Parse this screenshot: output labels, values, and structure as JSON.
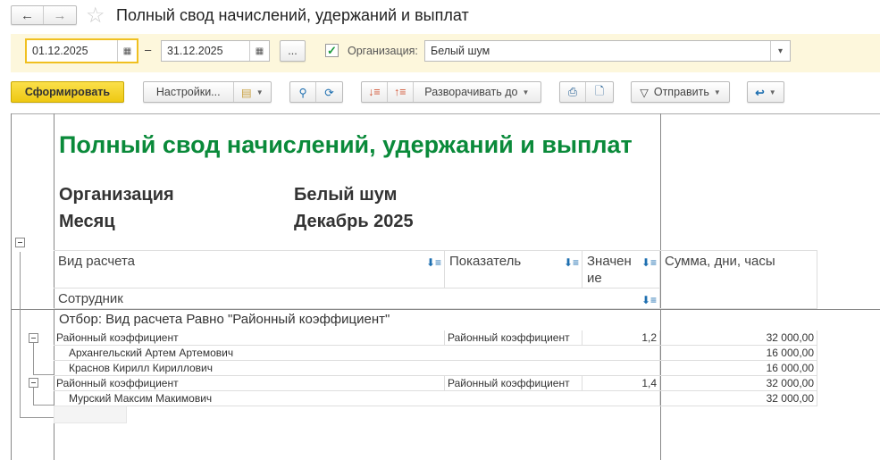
{
  "header": {
    "title": "Полный свод начислений, удержаний и выплат",
    "back": "←",
    "forward": "→",
    "star": "☆"
  },
  "filters": {
    "date_from": "01.12.2025",
    "date_to": "31.12.2025",
    "dash": "–",
    "more": "...",
    "org_label": "Организация:",
    "org_value": "Белый шум",
    "org_checked": true
  },
  "toolbar": {
    "generate": "Сформировать",
    "settings": "Настройки...",
    "expand_to": "Разворачивать до",
    "send": "Отправить"
  },
  "report": {
    "title": "Полный свод начислений, удержаний и выплат",
    "params": [
      {
        "label": "Организация",
        "value": "Белый шум"
      },
      {
        "label": "Месяц",
        "value": "Декабрь 2025"
      }
    ],
    "columns": {
      "calc_type": "Вид расчета",
      "indicator": "Показатель",
      "value": "Значен ие",
      "amount": "Сумма, дни, часы",
      "employee": "Сотрудник"
    },
    "filter_text": "Отбор: Вид расчета Равно \"Районный коэффициент\"",
    "rows": [
      {
        "name": "Районный коэффициент",
        "indicator": "Районный коэффициент",
        "value": "1,2",
        "amount": "32 000,00",
        "level": 0
      },
      {
        "name": "Архангельский Артем Артемович",
        "indicator": "",
        "value": "",
        "amount": "16 000,00",
        "level": 1
      },
      {
        "name": "Краснов Кирилл Кириллович",
        "indicator": "",
        "value": "",
        "amount": "16 000,00",
        "level": 1
      },
      {
        "name": "Районный коэффициент",
        "indicator": "Районный коэффициент",
        "value": "1,4",
        "amount": "32 000,00",
        "level": 0
      },
      {
        "name": "Мурский Максим Макимович",
        "indicator": "",
        "value": "",
        "amount": "32 000,00",
        "level": 1
      }
    ]
  },
  "colors": {
    "accent_title": "#0a8a3a",
    "generate_bg": "#f5d21c",
    "filter_bg": "#fdf7dc"
  }
}
